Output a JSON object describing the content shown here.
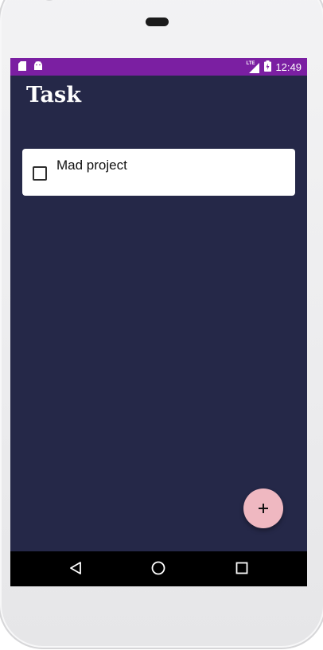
{
  "status_bar": {
    "time": "12:49",
    "network": "LTE",
    "background_color": "#7b1fa2",
    "icons_left": [
      "sd-card-icon",
      "android-icon"
    ],
    "icons_right": [
      "signal-icon",
      "battery-charging-icon"
    ]
  },
  "app": {
    "title": "Task",
    "background_color": "#252848"
  },
  "tasks": [
    {
      "label": "Mad project",
      "checked": false
    }
  ],
  "fab": {
    "icon": "plus-icon",
    "symbol": "+",
    "color": "#efb8c1"
  },
  "navigation": {
    "buttons": [
      "back-icon",
      "home-icon",
      "recents-icon"
    ]
  }
}
